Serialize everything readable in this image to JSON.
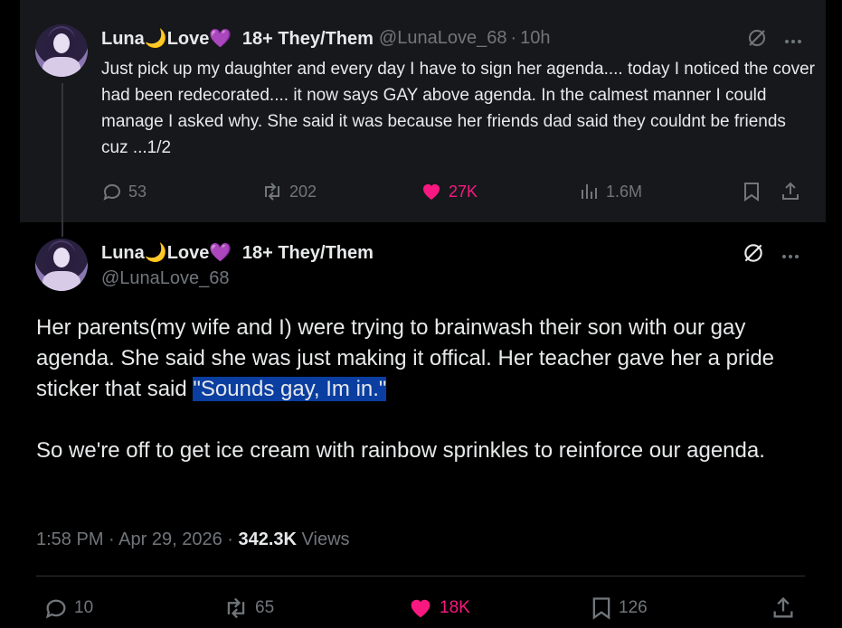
{
  "tweet1": {
    "name": "Luna",
    "name_moon": "🌙",
    "name_mid": "Love",
    "name_heart": "💜",
    "name_tail": "18+ They/Them",
    "handle": "@LunaLove_68",
    "time": "10h",
    "text": "Just pick up my daughter and every day I have to sign her agenda.... today I noticed the cover had been redecorated.... it now says GAY above agenda. In the calmest manner I could manage I asked why. She said it was because her friends dad said they couldnt be friends cuz ...1/2",
    "replies": "53",
    "reposts": "202",
    "likes": "27K",
    "views": "1.6M"
  },
  "tweet2": {
    "name": "Luna",
    "name_moon": "🌙",
    "name_mid": "Love",
    "name_heart": "💜",
    "name_tail": "18+ They/Them",
    "handle": "@LunaLove_68",
    "text_part1": "Her parents(my wife and I) were trying to brainwash their son with our gay agenda. She said she was just making it offical. Her teacher gave her a pride sticker that said ",
    "text_highlight": "\"Sounds gay, Im in.\"",
    "text_part2": "So we're off to get ice cream with rainbow sprinkles to reinforce our agenda.",
    "time": "1:58 PM",
    "date": "Apr 29, 2026",
    "views_count": "342.3K",
    "views_label": "Views",
    "replies": "10",
    "reposts": "65",
    "likes": "18K",
    "bookmarks": "126"
  },
  "colors": {
    "like": "#f91880",
    "muted": "#71767b",
    "highlight": "#0a3ea1"
  }
}
